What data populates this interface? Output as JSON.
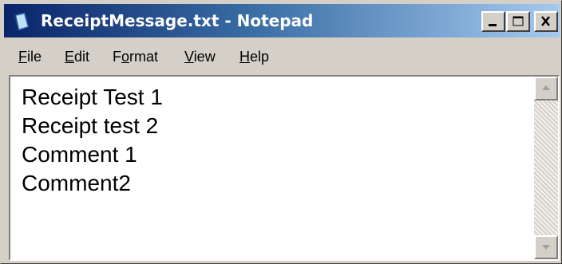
{
  "window": {
    "title": "ReceiptMessage.txt - Notepad",
    "icon": "notepad-icon",
    "controls": [
      "minimize-icon",
      "maximize-icon",
      "close-icon"
    ],
    "title_gradient": [
      "#0a246a",
      "#a6caf0"
    ]
  },
  "menu": {
    "file": {
      "mnemonic": "F",
      "rest": "ile"
    },
    "edit": {
      "mnemonic": "E",
      "rest": "dit"
    },
    "format": {
      "pre": "F",
      "mnemonic": "o",
      "rest": "rmat"
    },
    "view": {
      "mnemonic": "V",
      "rest": "iew"
    },
    "help": {
      "mnemonic": "H",
      "rest": "elp"
    }
  },
  "editor": {
    "lines": [
      "Receipt Test 1",
      "Receipt test 2",
      "Comment 1",
      "Comment2"
    ]
  }
}
